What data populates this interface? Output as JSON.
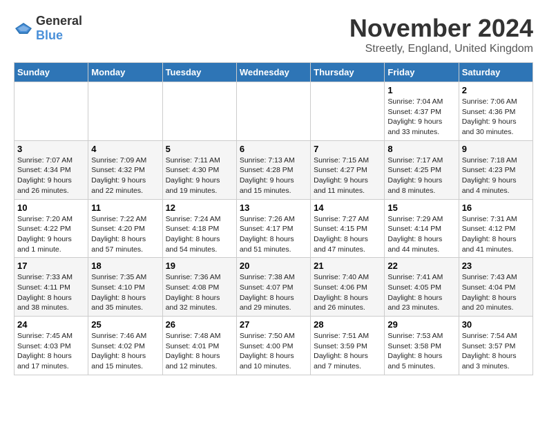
{
  "header": {
    "logo_general": "General",
    "logo_blue": "Blue",
    "title": "November 2024",
    "subtitle": "Streetly, England, United Kingdom"
  },
  "weekdays": [
    "Sunday",
    "Monday",
    "Tuesday",
    "Wednesday",
    "Thursday",
    "Friday",
    "Saturday"
  ],
  "weeks": [
    [
      {
        "day": "",
        "info": ""
      },
      {
        "day": "",
        "info": ""
      },
      {
        "day": "",
        "info": ""
      },
      {
        "day": "",
        "info": ""
      },
      {
        "day": "",
        "info": ""
      },
      {
        "day": "1",
        "info": "Sunrise: 7:04 AM\nSunset: 4:37 PM\nDaylight: 9 hours and 33 minutes."
      },
      {
        "day": "2",
        "info": "Sunrise: 7:06 AM\nSunset: 4:36 PM\nDaylight: 9 hours and 30 minutes."
      }
    ],
    [
      {
        "day": "3",
        "info": "Sunrise: 7:07 AM\nSunset: 4:34 PM\nDaylight: 9 hours and 26 minutes."
      },
      {
        "day": "4",
        "info": "Sunrise: 7:09 AM\nSunset: 4:32 PM\nDaylight: 9 hours and 22 minutes."
      },
      {
        "day": "5",
        "info": "Sunrise: 7:11 AM\nSunset: 4:30 PM\nDaylight: 9 hours and 19 minutes."
      },
      {
        "day": "6",
        "info": "Sunrise: 7:13 AM\nSunset: 4:28 PM\nDaylight: 9 hours and 15 minutes."
      },
      {
        "day": "7",
        "info": "Sunrise: 7:15 AM\nSunset: 4:27 PM\nDaylight: 9 hours and 11 minutes."
      },
      {
        "day": "8",
        "info": "Sunrise: 7:17 AM\nSunset: 4:25 PM\nDaylight: 9 hours and 8 minutes."
      },
      {
        "day": "9",
        "info": "Sunrise: 7:18 AM\nSunset: 4:23 PM\nDaylight: 9 hours and 4 minutes."
      }
    ],
    [
      {
        "day": "10",
        "info": "Sunrise: 7:20 AM\nSunset: 4:22 PM\nDaylight: 9 hours and 1 minute."
      },
      {
        "day": "11",
        "info": "Sunrise: 7:22 AM\nSunset: 4:20 PM\nDaylight: 8 hours and 57 minutes."
      },
      {
        "day": "12",
        "info": "Sunrise: 7:24 AM\nSunset: 4:18 PM\nDaylight: 8 hours and 54 minutes."
      },
      {
        "day": "13",
        "info": "Sunrise: 7:26 AM\nSunset: 4:17 PM\nDaylight: 8 hours and 51 minutes."
      },
      {
        "day": "14",
        "info": "Sunrise: 7:27 AM\nSunset: 4:15 PM\nDaylight: 8 hours and 47 minutes."
      },
      {
        "day": "15",
        "info": "Sunrise: 7:29 AM\nSunset: 4:14 PM\nDaylight: 8 hours and 44 minutes."
      },
      {
        "day": "16",
        "info": "Sunrise: 7:31 AM\nSunset: 4:12 PM\nDaylight: 8 hours and 41 minutes."
      }
    ],
    [
      {
        "day": "17",
        "info": "Sunrise: 7:33 AM\nSunset: 4:11 PM\nDaylight: 8 hours and 38 minutes."
      },
      {
        "day": "18",
        "info": "Sunrise: 7:35 AM\nSunset: 4:10 PM\nDaylight: 8 hours and 35 minutes."
      },
      {
        "day": "19",
        "info": "Sunrise: 7:36 AM\nSunset: 4:08 PM\nDaylight: 8 hours and 32 minutes."
      },
      {
        "day": "20",
        "info": "Sunrise: 7:38 AM\nSunset: 4:07 PM\nDaylight: 8 hours and 29 minutes."
      },
      {
        "day": "21",
        "info": "Sunrise: 7:40 AM\nSunset: 4:06 PM\nDaylight: 8 hours and 26 minutes."
      },
      {
        "day": "22",
        "info": "Sunrise: 7:41 AM\nSunset: 4:05 PM\nDaylight: 8 hours and 23 minutes."
      },
      {
        "day": "23",
        "info": "Sunrise: 7:43 AM\nSunset: 4:04 PM\nDaylight: 8 hours and 20 minutes."
      }
    ],
    [
      {
        "day": "24",
        "info": "Sunrise: 7:45 AM\nSunset: 4:03 PM\nDaylight: 8 hours and 17 minutes."
      },
      {
        "day": "25",
        "info": "Sunrise: 7:46 AM\nSunset: 4:02 PM\nDaylight: 8 hours and 15 minutes."
      },
      {
        "day": "26",
        "info": "Sunrise: 7:48 AM\nSunset: 4:01 PM\nDaylight: 8 hours and 12 minutes."
      },
      {
        "day": "27",
        "info": "Sunrise: 7:50 AM\nSunset: 4:00 PM\nDaylight: 8 hours and 10 minutes."
      },
      {
        "day": "28",
        "info": "Sunrise: 7:51 AM\nSunset: 3:59 PM\nDaylight: 8 hours and 7 minutes."
      },
      {
        "day": "29",
        "info": "Sunrise: 7:53 AM\nSunset: 3:58 PM\nDaylight: 8 hours and 5 minutes."
      },
      {
        "day": "30",
        "info": "Sunrise: 7:54 AM\nSunset: 3:57 PM\nDaylight: 8 hours and 3 minutes."
      }
    ]
  ]
}
